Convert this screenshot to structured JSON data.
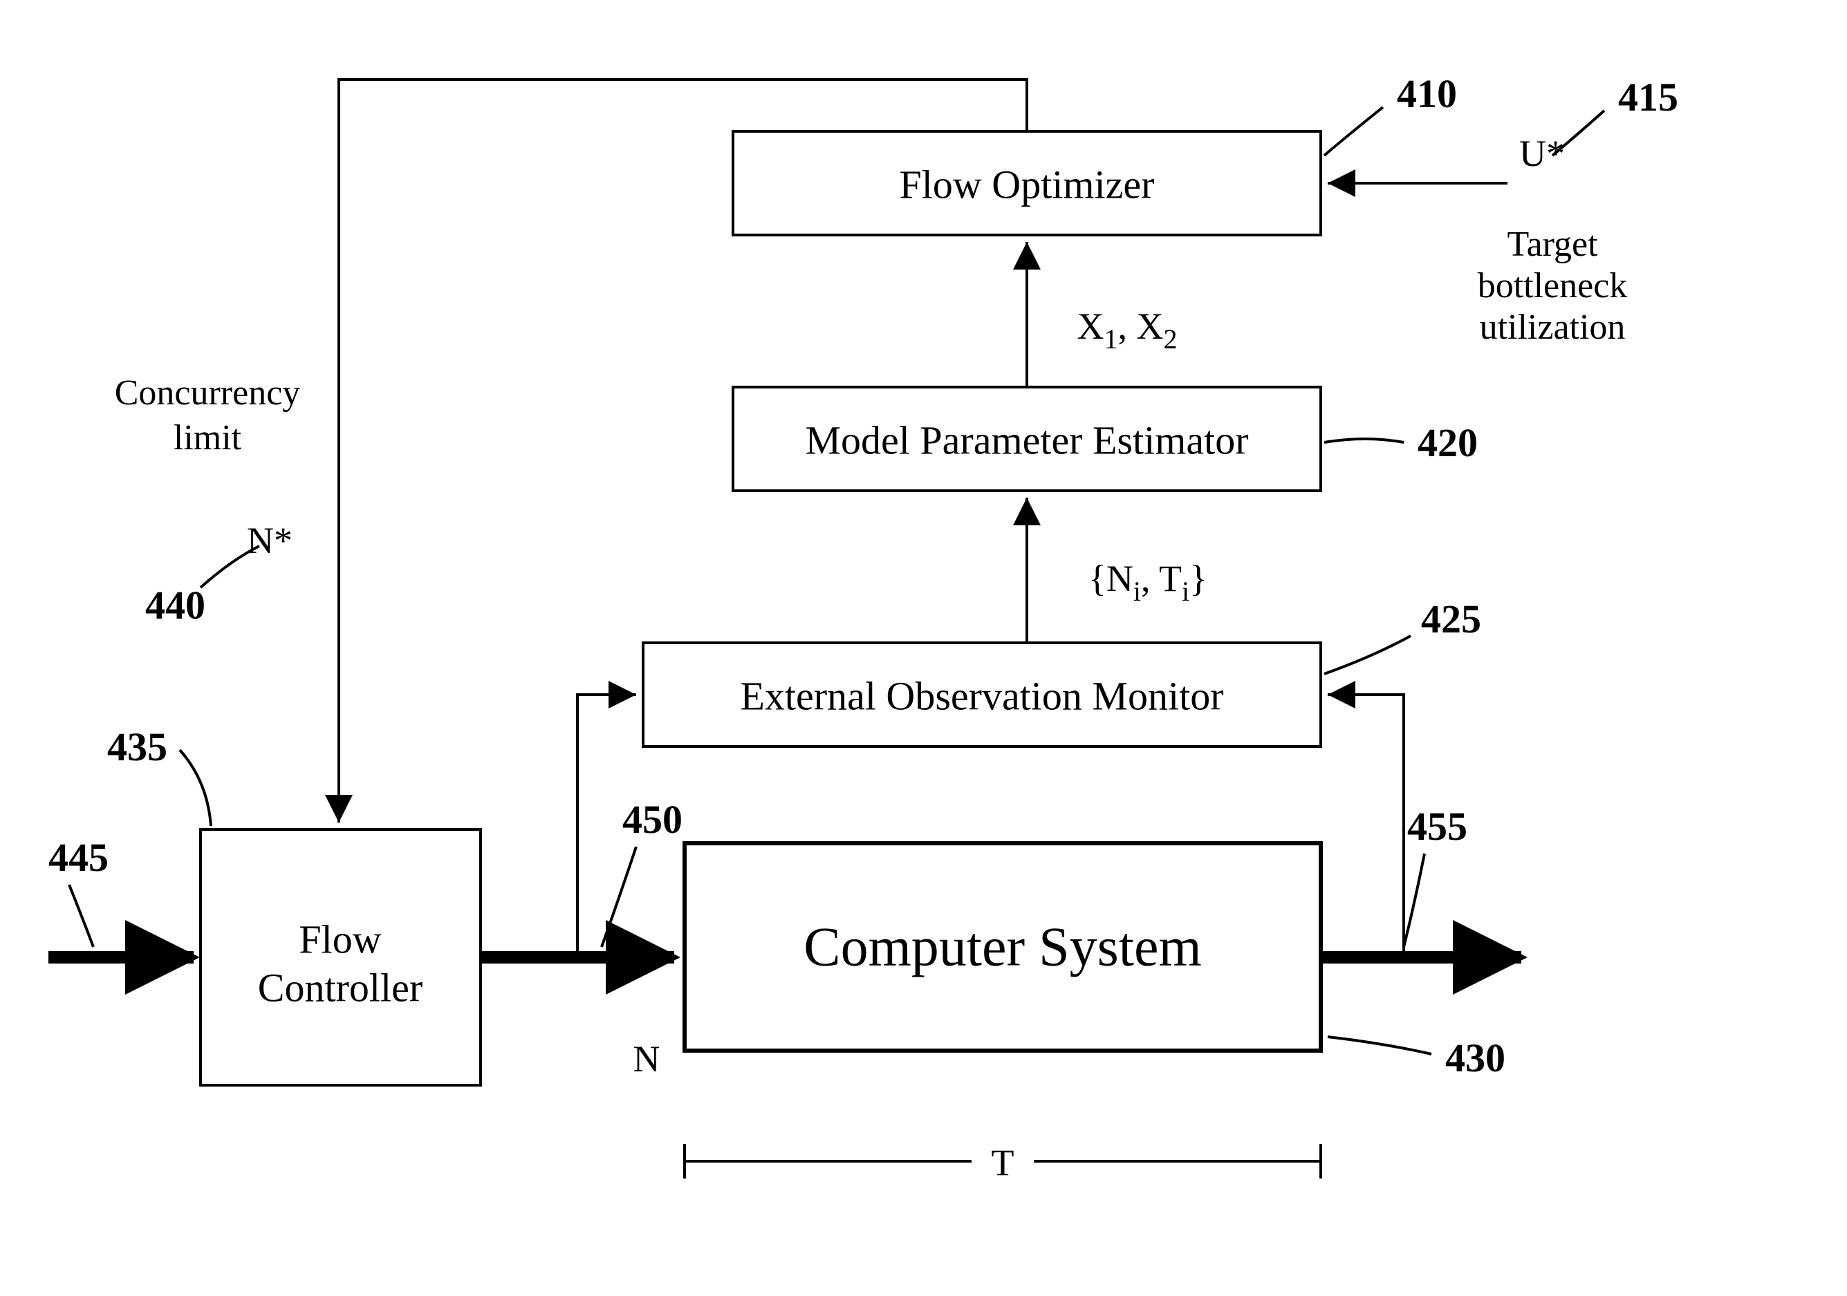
{
  "boxes": {
    "flow_optimizer": "Flow Optimizer",
    "model_param_estimator": "Model Parameter Estimator",
    "external_obs_monitor": "External Observation Monitor",
    "computer_system": "Computer System",
    "flow_controller_l1": "Flow",
    "flow_controller_l2": "Controller"
  },
  "refs": {
    "r410": "410",
    "r415": "415",
    "r420": "420",
    "r425": "425",
    "r430": "430",
    "r435": "435",
    "r440": "440",
    "r445": "445",
    "r450": "450",
    "r455": "455"
  },
  "signals": {
    "x1x2_pre": "X",
    "x1x2_s1": "1",
    "x1x2_mid": ", X",
    "x1x2_s2": "2",
    "ni_pre": "{N",
    "ni_s": "i",
    "ni_mid": ", T",
    "ti_s": "i",
    "ni_post": "}",
    "n_star": "N*",
    "u_star": "U*",
    "N": "N",
    "T": "T"
  },
  "annotations": {
    "concurrency_l1": "Concurrency",
    "concurrency_l2": "limit",
    "target_l1": "Target",
    "target_l2": "bottleneck",
    "target_l3": "utilization"
  }
}
